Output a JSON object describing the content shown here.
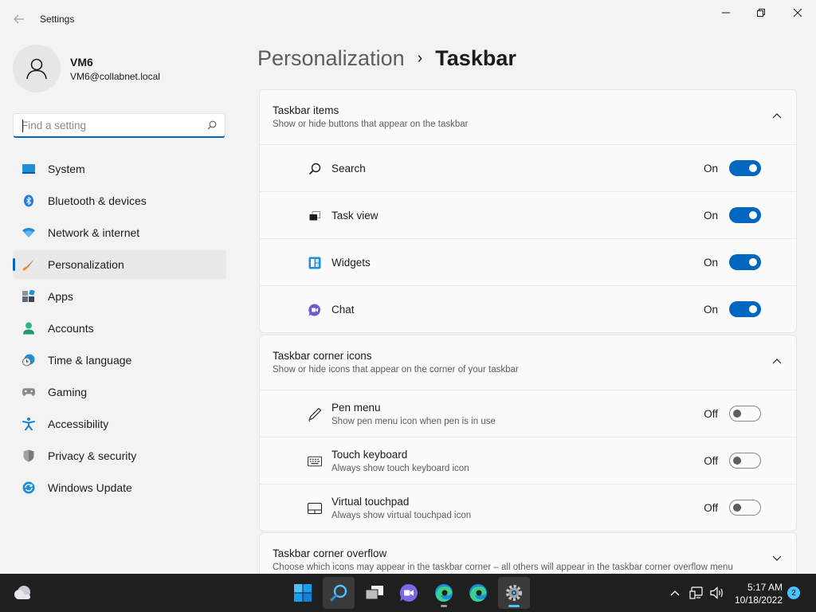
{
  "app": {
    "title": "Settings"
  },
  "profile": {
    "name": "VM6",
    "email": "VM6@collabnet.local"
  },
  "search": {
    "placeholder": "Find a setting"
  },
  "sidebar": {
    "items": [
      {
        "label": "System",
        "icon": "system-icon"
      },
      {
        "label": "Bluetooth & devices",
        "icon": "bluetooth-icon"
      },
      {
        "label": "Network & internet",
        "icon": "wifi-icon"
      },
      {
        "label": "Personalization",
        "icon": "brush-icon",
        "active": true
      },
      {
        "label": "Apps",
        "icon": "apps-icon"
      },
      {
        "label": "Accounts",
        "icon": "accounts-icon"
      },
      {
        "label": "Time & language",
        "icon": "clock-globe-icon"
      },
      {
        "label": "Gaming",
        "icon": "gamepad-icon"
      },
      {
        "label": "Accessibility",
        "icon": "accessibility-icon"
      },
      {
        "label": "Privacy & security",
        "icon": "shield-icon"
      },
      {
        "label": "Windows Update",
        "icon": "update-icon"
      }
    ]
  },
  "breadcrumb": {
    "parent": "Personalization",
    "separator": "›",
    "current": "Taskbar"
  },
  "sections": {
    "taskbar_items": {
      "title": "Taskbar items",
      "subtitle": "Show or hide buttons that appear on the taskbar",
      "rows": [
        {
          "label": "Search",
          "state": "On",
          "icon": "search-icon"
        },
        {
          "label": "Task view",
          "state": "On",
          "icon": "task-view-icon"
        },
        {
          "label": "Widgets",
          "state": "On",
          "icon": "widgets-icon"
        },
        {
          "label": "Chat",
          "state": "On",
          "icon": "chat-icon"
        }
      ]
    },
    "corner_icons": {
      "title": "Taskbar corner icons",
      "subtitle": "Show or hide icons that appear on the corner of your taskbar",
      "rows": [
        {
          "label": "Pen menu",
          "desc": "Show pen menu icon when pen is in use",
          "state": "Off",
          "icon": "pen-icon"
        },
        {
          "label": "Touch keyboard",
          "desc": "Always show touch keyboard icon",
          "state": "Off",
          "icon": "keyboard-icon"
        },
        {
          "label": "Virtual touchpad",
          "desc": "Always show virtual touchpad icon",
          "state": "Off",
          "icon": "touchpad-icon"
        }
      ]
    },
    "corner_overflow": {
      "title": "Taskbar corner overflow",
      "subtitle": "Choose which icons may appear in the taskbar corner – all others will appear in the taskbar corner overflow menu"
    }
  },
  "taskbar": {
    "time": "5:17 AM",
    "date": "10/18/2022",
    "notification_count": "2"
  },
  "colors": {
    "accent": "#0067c0",
    "taskbar_bg": "#1f1f1f"
  }
}
